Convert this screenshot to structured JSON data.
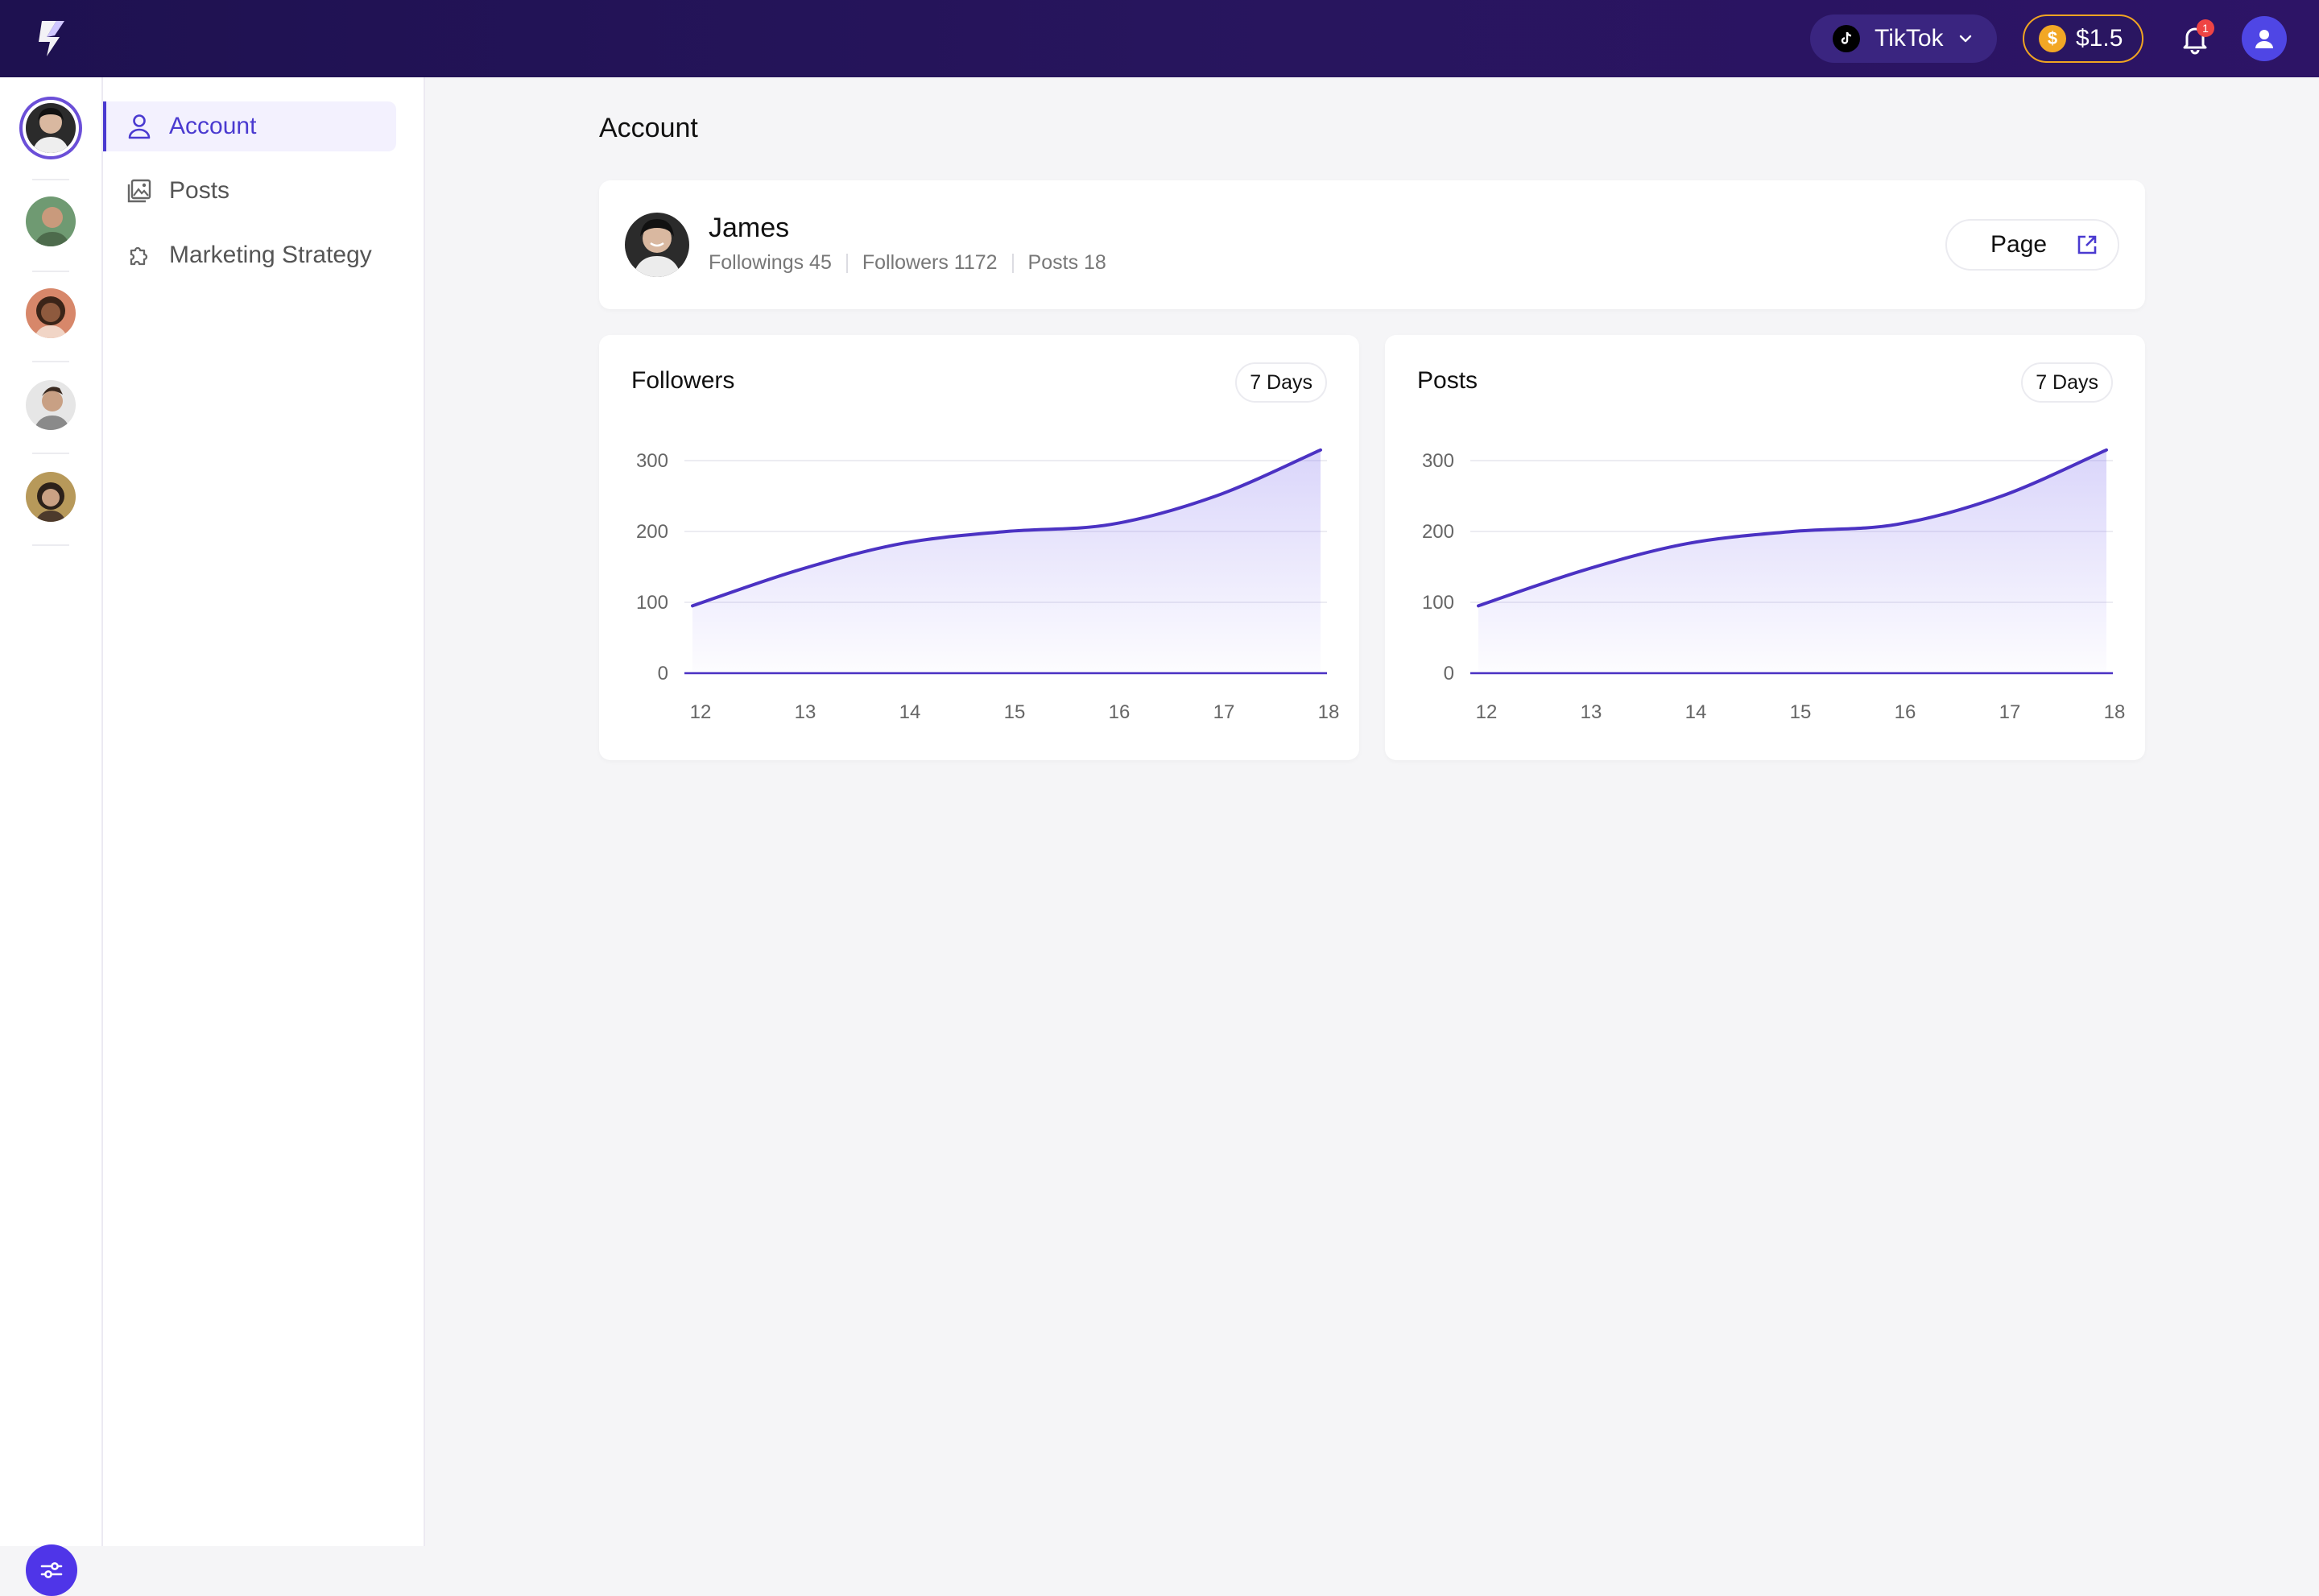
{
  "topbar": {
    "platform_label": "TikTok",
    "balance": "$1.5",
    "coin_symbol": "$",
    "notification_count": "1",
    "brand_color": "#27155d",
    "accent_color": "#4f35e8"
  },
  "sidebar": {
    "items": [
      {
        "label": "Account",
        "icon": "user-icon",
        "active": true
      },
      {
        "label": "Posts",
        "icon": "image-gallery-icon",
        "active": false
      },
      {
        "label": "Marketing Strategy",
        "icon": "puzzle-icon",
        "active": false
      }
    ]
  },
  "accounts_rail": {
    "avatars": [
      "avatar-active",
      "avatar-2",
      "avatar-3",
      "avatar-4",
      "avatar-5"
    ]
  },
  "main": {
    "title": "Account",
    "profile": {
      "name": "James",
      "followings_label": "Followings 45",
      "followers_label": "Followers 1172",
      "posts_label": "Posts 18",
      "page_button": "Page"
    }
  },
  "chart_data": [
    {
      "type": "area",
      "title": "Followers",
      "range_label": "7 Days",
      "x": [
        "12",
        "13",
        "14",
        "15",
        "16",
        "17",
        "18"
      ],
      "series": [
        {
          "values": [
            95,
            145,
            183,
            200,
            210,
            250,
            315
          ]
        }
      ],
      "yticks": [
        "0",
        "100",
        "200",
        "300"
      ],
      "ylim": [
        0,
        300
      ],
      "grid": true,
      "color": "#4b32c3"
    },
    {
      "type": "area",
      "title": "Posts",
      "range_label": "7 Days",
      "x": [
        "12",
        "13",
        "14",
        "15",
        "16",
        "17",
        "18"
      ],
      "series": [
        {
          "values": [
            95,
            145,
            183,
            200,
            210,
            250,
            315
          ]
        }
      ],
      "yticks": [
        "0",
        "100",
        "200",
        "300"
      ],
      "ylim": [
        0,
        300
      ],
      "grid": true,
      "color": "#4b32c3"
    }
  ]
}
